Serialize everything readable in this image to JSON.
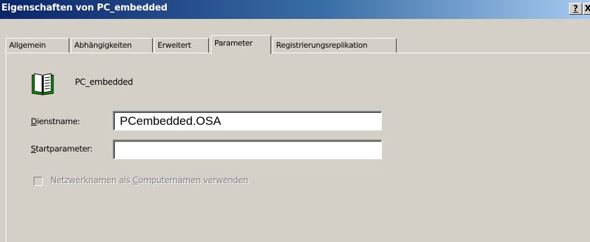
{
  "window": {
    "title": "Eigenschaften von PC_embedded",
    "help_label": "?",
    "close_label": "X"
  },
  "tabs": [
    {
      "label": "Allgemein",
      "active": false
    },
    {
      "label": "Abhängigkeiten",
      "active": false
    },
    {
      "label": "Erweitert",
      "active": false
    },
    {
      "label": "Parameter",
      "active": true
    },
    {
      "label": "Registrierungsreplikation",
      "active": false
    }
  ],
  "service": {
    "icon": "book-icon",
    "name": "PC_embedded"
  },
  "form": {
    "dienstname_label_acc": "D",
    "dienstname_label_rest": "ienstname:",
    "dienstname_value": "PCembedded.OSA",
    "startparameter_label_acc": "S",
    "startparameter_label_rest": "tartparameter:",
    "startparameter_value": "",
    "checkbox_label_pre": "Netzwerknamen als ",
    "checkbox_label_acc": "C",
    "checkbox_label_post": "omputernamen verwenden",
    "checkbox_checked": false,
    "checkbox_enabled": false
  },
  "colors": {
    "title_start": "#0a246a",
    "title_end": "#a6caf0",
    "face": "#d4d0c8"
  }
}
